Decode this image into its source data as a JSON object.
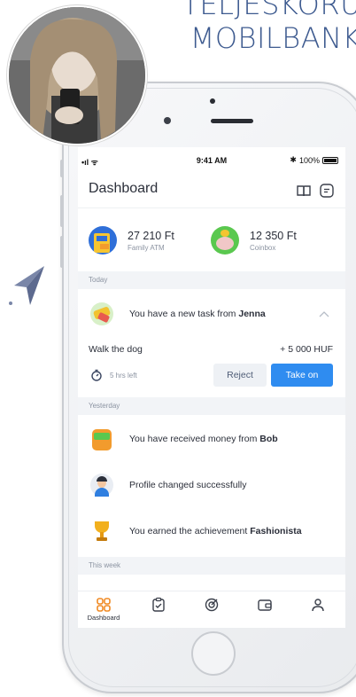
{
  "headline": {
    "line1": "TELJESKÖRŰ",
    "line2": "MOBILBANK"
  },
  "status": {
    "time": "9:41 AM",
    "battery": "100%",
    "signal": "•ıl ᯤ",
    "bluetooth": "✱"
  },
  "appbar": {
    "title": "Dashboard",
    "icons": [
      "book-icon",
      "chat-icon"
    ]
  },
  "accounts": [
    {
      "amount": "27 210 Ft",
      "label": "Family ATM",
      "icon": "atm-icon"
    },
    {
      "amount": "12 350 Ft",
      "label": "Coinbox",
      "icon": "piggy-icon"
    }
  ],
  "sections": {
    "today": "Today",
    "yesterday": "Yesterday",
    "this_week": "This week"
  },
  "task": {
    "text": "You have a new task from ",
    "from": "Jenna",
    "title": "Walk the dog",
    "reward": "+ 5 000 HUF",
    "time_left": "5 hrs left",
    "reject_label": "Reject",
    "accept_label": "Take on"
  },
  "activity": [
    {
      "text": "You have received money from ",
      "bold": "Bob",
      "icon": "wallet-icon"
    },
    {
      "text": "Profile changed successfully",
      "bold": "",
      "icon": "avatar-icon"
    },
    {
      "text": "You earned the achievement ",
      "bold": "Fashionista",
      "icon": "trophy-icon"
    }
  ],
  "tabs": [
    {
      "label": "Dashboard",
      "icon": "dashboard-icon",
      "active": true
    },
    {
      "label": "",
      "icon": "tasks-icon",
      "active": false
    },
    {
      "label": "",
      "icon": "goals-icon",
      "active": false
    },
    {
      "label": "",
      "icon": "wallet-icon",
      "active": false
    },
    {
      "label": "",
      "icon": "profile-icon",
      "active": false
    }
  ],
  "colors": {
    "accent": "#2f8cf0",
    "headline": "#3d5a8f",
    "active_tab": "#f08a24",
    "plane": "#7a86a8"
  }
}
